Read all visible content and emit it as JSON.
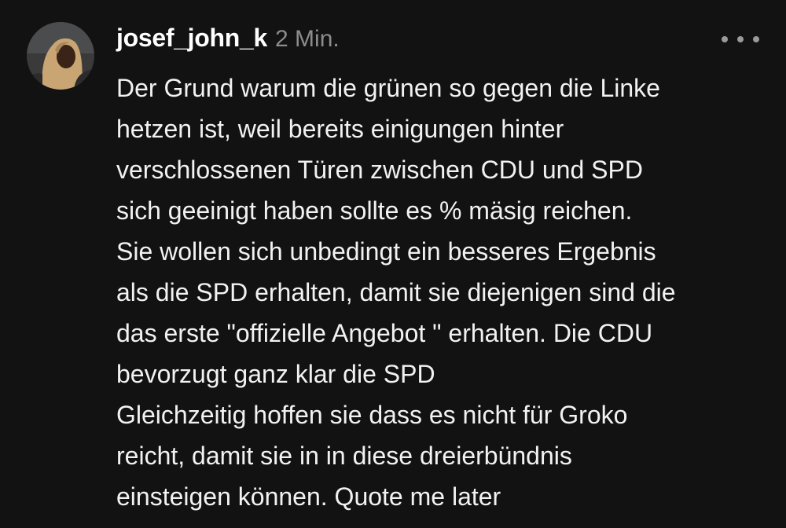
{
  "comment": {
    "username": "josef_john_k",
    "timestamp": "2 Min.",
    "avatar_icon": "user-avatar",
    "more_icon": "more-horizontal-icon",
    "lines": [
      "Der Grund warum die grünen so gegen die Linke",
      "hetzen ist, weil bereits einigungen hinter",
      "verschlossenen Türen zwischen CDU und SPD",
      "sich geeinigt haben sollte es % mäsig reichen.",
      "Sie wollen sich unbedingt ein besseres Ergebnis",
      "als die SPD erhalten, damit sie diejenigen sind die",
      "das erste \"offizielle Angebot \" erhalten. Die CDU",
      "bevorzugt ganz klar die SPD",
      "Gleichzeitig hoffen sie dass es nicht für Groko",
      "reicht, damit sie in in diese dreierbündnis",
      "einsteigen können. Quote me later"
    ]
  },
  "colors": {
    "background": "#121212",
    "text": "#f2f2f2",
    "muted": "#8c8c8c"
  }
}
